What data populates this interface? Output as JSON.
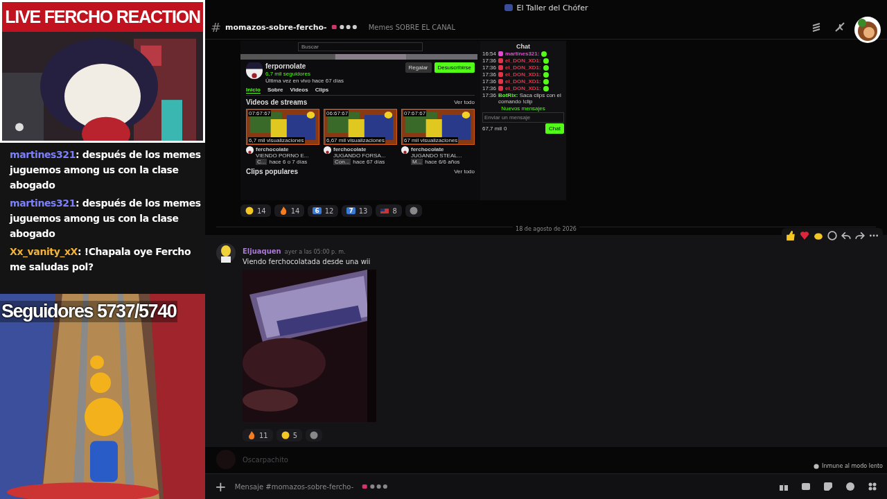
{
  "stream_overlay": {
    "title": "LIVE FERCHO REACTION",
    "chat": [
      {
        "user": "martines321",
        "color": "#7c80ff",
        "separator": ":",
        "text": "después de los memes juguemos among us con la clase abogado"
      },
      {
        "user": "martines321",
        "color": "#7c80ff",
        "separator": ":",
        "text": "después de los memes juguemos among us con la clase abogado"
      },
      {
        "user": "Xx_vanity_xX",
        "color": "#f2b33a",
        "separator": ":",
        "text": "!Chapala oye Fercho me saludas pol?"
      }
    ],
    "follower_goal": "Seguidores 5737/5740"
  },
  "window": {
    "title": "El Taller del Chófer"
  },
  "channel": {
    "icon": "#",
    "name": "momazos-sobre-fercho-",
    "topic": "Memes SOBRE EL CANAL"
  },
  "shared_screenshot": {
    "search": "Buscar",
    "profile_name": "ferpornolate",
    "followers": "6,7 mil seguidores",
    "last_live": "Última vez en vivo hace 67 días",
    "buttons": [
      {
        "label": "Regalar",
        "kind": "plain"
      },
      {
        "label": "Desuscribirse",
        "kind": "primary"
      }
    ],
    "tabs": [
      {
        "label": "Inicio",
        "selected": true
      },
      {
        "label": "Sobre",
        "selected": false
      },
      {
        "label": "Videos",
        "selected": false
      },
      {
        "label": "Clips",
        "selected": false
      }
    ],
    "videos_heading": "Videos de streams",
    "see_all": "Ver todo",
    "videos": [
      {
        "duration": "07:67:67",
        "views": "6,7 mil visualizaciones",
        "channel": "ferchocolate",
        "title": "VIENDO PORNO E...",
        "category": "C...",
        "age": "hace 6 o 7 días"
      },
      {
        "duration": "06:67:67",
        "views": "6,67 mil visualizaciones",
        "channel": "ferchocolate",
        "title": "JUGANDO FORSA...",
        "category": "Con...",
        "age": "hace 67 días"
      },
      {
        "duration": "07:67:67",
        "views": "67 mil visualizaciones",
        "channel": "ferchocolate",
        "title": "JUGANDO STEAL...",
        "category": "M...",
        "age": "hace 6/6 años"
      }
    ],
    "clips_heading": "Clips populares",
    "clips_see_all": "Ver todo",
    "chat_title": "Chat",
    "chat_lines": [
      {
        "time": "16:54",
        "user": "martines321:",
        "color": "#e24bd0"
      },
      {
        "time": "17:36",
        "user": "el_DON_XD1:",
        "color": "#e2344a"
      },
      {
        "time": "17:36",
        "user": "el_DON_XD1:",
        "color": "#e2344a"
      },
      {
        "time": "17:36",
        "user": "el_DON_XD1:",
        "color": "#e2344a"
      },
      {
        "time": "17:36",
        "user": "el_DON_XD1:",
        "color": "#e2344a"
      },
      {
        "time": "17:36",
        "user": "el_DON_XD1:",
        "color": "#e2344a"
      }
    ],
    "bot_line": {
      "time": "17:36",
      "user": "BotRix:",
      "text": "Saca clips con el comando !clip"
    },
    "new_messages": "Nuevos mensajes",
    "chat_placeholder": "Enviar un mensaje",
    "viewers": "67,7 mil",
    "points": "0",
    "chat_button": "Chat"
  },
  "top_reactions": [
    {
      "kind": "smile",
      "count": "14"
    },
    {
      "kind": "fire",
      "count": "14"
    },
    {
      "kind": "keycap",
      "key": "6",
      "count": "12"
    },
    {
      "kind": "keycap",
      "key": "7",
      "count": "13"
    },
    {
      "kind": "flag",
      "count": "8"
    }
  ],
  "date_divider": "18 de agosto de 2026",
  "message": {
    "author": "Eljuaquen",
    "time": "ayer a las 05:00 p. m.",
    "text": "Viendo ferchocolatada desde una wii",
    "reactions": [
      {
        "kind": "fire",
        "count": "11"
      },
      {
        "kind": "smile",
        "count": "5"
      }
    ]
  },
  "next_author": "Oscarpachito",
  "slowmode_note": "Inmune al modo lento",
  "composer": {
    "add_button": "+",
    "placeholder": "Mensaje #momazos-sobre-fercho-"
  }
}
